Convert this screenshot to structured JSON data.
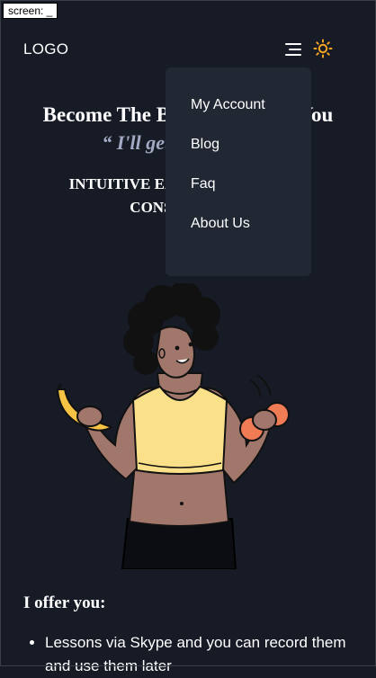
{
  "screen_tag": "screen: _",
  "header": {
    "logo": "LOGO",
    "menu_icon": "hamburger-menu-icon",
    "theme_icon": "sun-icon"
  },
  "hero": {
    "title": "Become The Best Version Of You",
    "quote": "“ I'll get you there! ”",
    "subtitle": "Intuitive eating & mindful consumption"
  },
  "dropdown": {
    "items": [
      "My Account",
      "Blog",
      "Faq",
      "About Us"
    ]
  },
  "offer": {
    "title": "I offer you:",
    "items": [
      "Lessons via Skype and you can record them and use them later"
    ]
  },
  "colors": {
    "background": "#161b26",
    "dropdown_bg": "#212733",
    "sun": "#f5a623",
    "quote": "#a3abc4"
  }
}
